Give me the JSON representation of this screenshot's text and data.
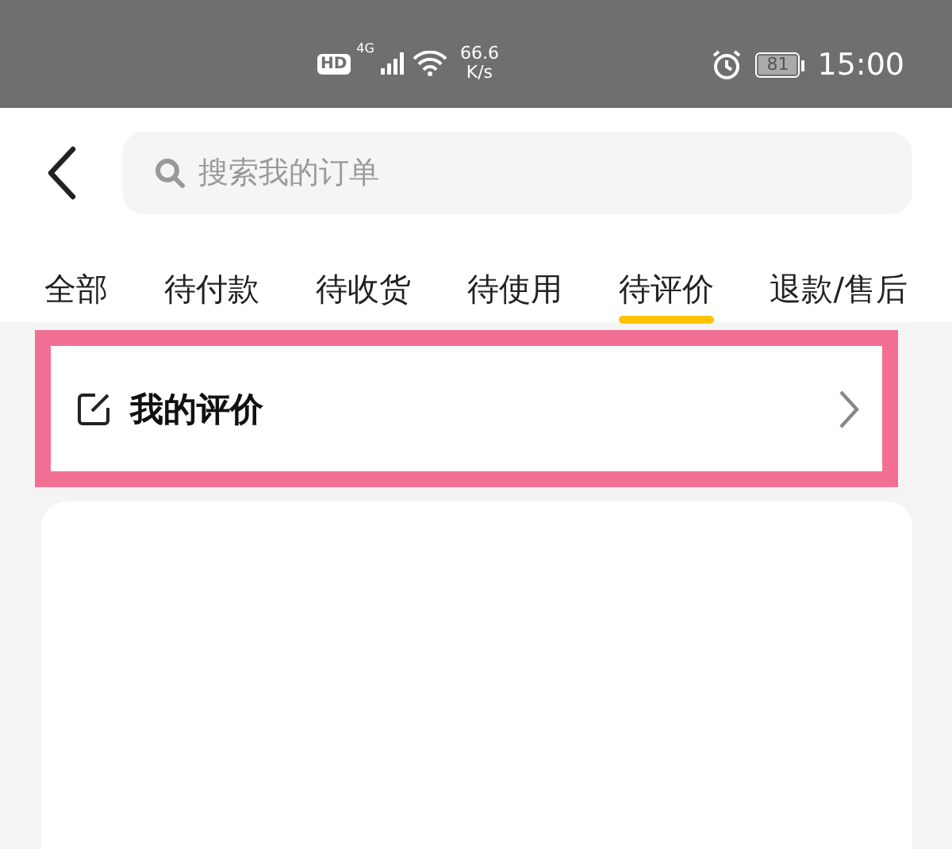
{
  "status_bar": {
    "hd": "HD",
    "network": "4G",
    "speed_value": "66.6",
    "speed_unit": "K/s",
    "battery": "81",
    "time": "15:00"
  },
  "search": {
    "placeholder": "搜索我的订单"
  },
  "tabs": [
    {
      "label": "全部",
      "selected": false
    },
    {
      "label": "待付款",
      "selected": false
    },
    {
      "label": "待收货",
      "selected": false
    },
    {
      "label": "待使用",
      "selected": false
    },
    {
      "label": "待评价",
      "selected": true
    },
    {
      "label": "退款/售后",
      "selected": false
    }
  ],
  "my_reviews": {
    "label": "我的评价",
    "highlighted": true
  }
}
